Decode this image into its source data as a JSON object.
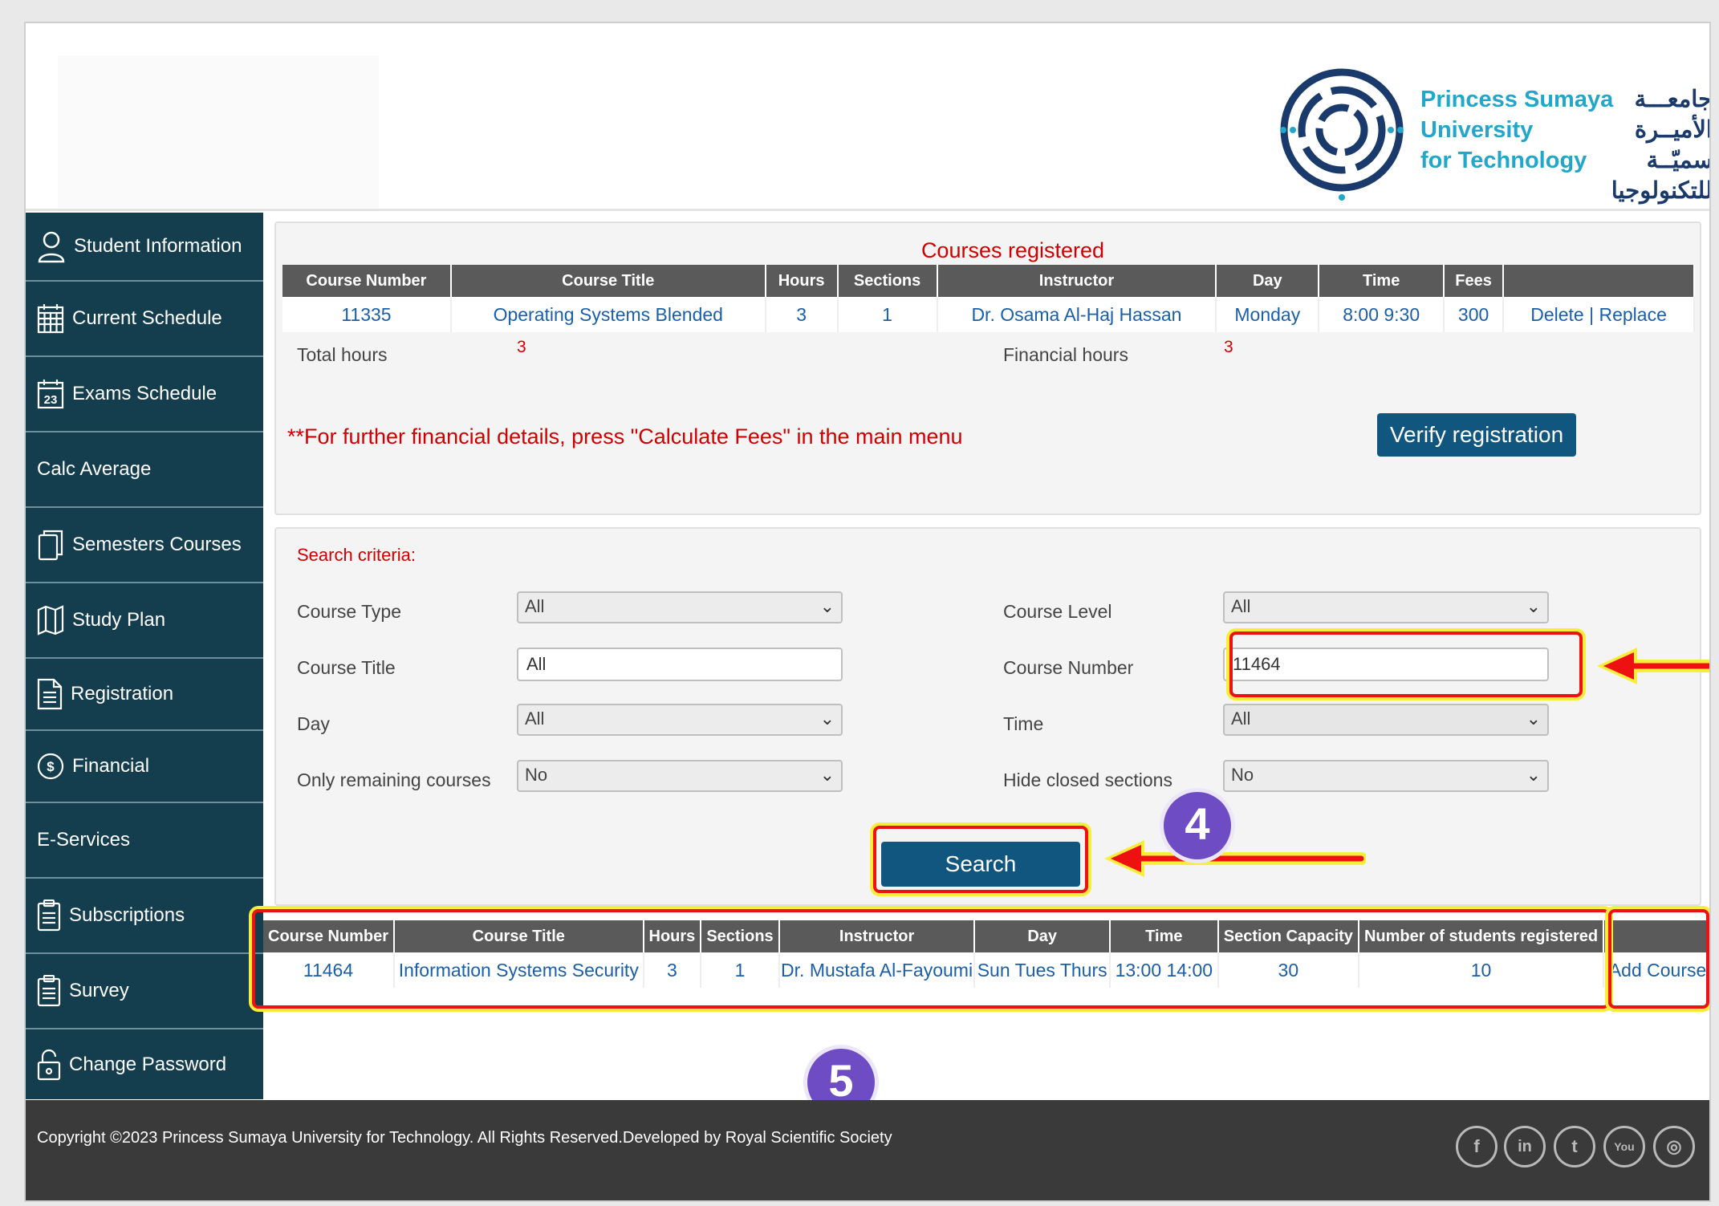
{
  "header": {
    "logo_en_line1": "Princess Sumaya",
    "logo_en_line2": "University",
    "logo_en_line3": "for Technology",
    "logo_ar_line1": "جامعـــة",
    "logo_ar_line2": "الأميــرة سميّــة",
    "logo_ar_line3": "للتكنولوجيا"
  },
  "sidebar": {
    "items": [
      {
        "label": "Student Information",
        "icon": "user-icon"
      },
      {
        "label": "Current Schedule",
        "icon": "calendar-icon"
      },
      {
        "label": "Exams Schedule",
        "icon": "calendar-23-icon"
      },
      {
        "label": "Calc Average",
        "icon": ""
      },
      {
        "label": "Semesters Courses",
        "icon": "copy-icon"
      },
      {
        "label": "Study Plan",
        "icon": "map-icon"
      },
      {
        "label": "Registration",
        "icon": "document-icon"
      },
      {
        "label": "Financial",
        "icon": "dollar-icon"
      },
      {
        "label": "E-Services",
        "icon": ""
      },
      {
        "label": "Subscriptions",
        "icon": "clipboard-icon"
      },
      {
        "label": "Survey",
        "icon": "clipboard-icon"
      },
      {
        "label": "Change Password",
        "icon": "lock-icon"
      }
    ]
  },
  "registered": {
    "title": "Courses registered",
    "columns": [
      "Course Number",
      "Course Title",
      "Hours",
      "Sections",
      "Instructor",
      "Day",
      "Time",
      "Fees",
      ""
    ],
    "rows": [
      {
        "number": "11335",
        "title": "Operating Systems Blended",
        "hours": "3",
        "sections": "1",
        "instructor": "Dr. Osama Al-Haj Hassan",
        "day": "Monday",
        "time": "8:00 9:30",
        "fees": "300",
        "delete": "Delete",
        "sep": "|",
        "replace": "Replace"
      }
    ],
    "total_hours_label": "Total hours",
    "total_hours_value": "3",
    "financial_hours_label": "Financial hours",
    "financial_hours_value": "3",
    "note": "**For further financial details, press \"Calculate Fees\" in the main menu",
    "verify_button": "Verify registration"
  },
  "search": {
    "title": "Search criteria:",
    "course_type_label": "Course Type",
    "course_type_value": "All",
    "course_title_label": "Course Title",
    "course_title_value": "All",
    "day_label": "Day",
    "day_value": "All",
    "remaining_label": "Only remaining courses",
    "remaining_value": "No",
    "course_level_label": "Course Level",
    "course_level_value": "All",
    "course_number_label": "Course Number",
    "course_number_value": "11464",
    "time_label": "Time",
    "time_value": "All",
    "hide_closed_label": "Hide closed sections",
    "hide_closed_value": "No",
    "search_button": "Search"
  },
  "results": {
    "columns": [
      "Course Number",
      "Course Title",
      "Hours",
      "Sections",
      "Instructor",
      "Day",
      "Time",
      "Section Capacity",
      "Number of students registered"
    ],
    "rows": [
      {
        "number": "11464",
        "title": "Information Systems Security",
        "hours": "3",
        "sections": "1",
        "instructor": "Dr. Mustafa Al-Fayoumi",
        "day": "Sun Tues Thurs",
        "time": "13:00 14:00",
        "capacity": "30",
        "registered": "10",
        "action": "Add Course"
      }
    ]
  },
  "annotations": {
    "step4": "4",
    "step5": "5"
  },
  "footer": {
    "copyright": "Copyright ©2023 Princess Sumaya University for Technology. All Rights Reserved.Developed by Royal Scientific Society",
    "social": [
      {
        "glyph": "f",
        "icon": "facebook-icon"
      },
      {
        "glyph": "in",
        "icon": "linkedin-icon"
      },
      {
        "glyph": "t",
        "icon": "twitter-icon"
      },
      {
        "glyph": "You",
        "icon": "youtube-icon"
      },
      {
        "glyph": "◎",
        "icon": "instagram-icon"
      }
    ]
  },
  "colors": {
    "sidebar_bg": "#143d4e",
    "button_bg": "#11567f",
    "link": "#1b5fa8",
    "alert_red": "#d10000",
    "badge_purple": "#6d4cc4",
    "highlight_yellow": "#f8ee3a"
  }
}
